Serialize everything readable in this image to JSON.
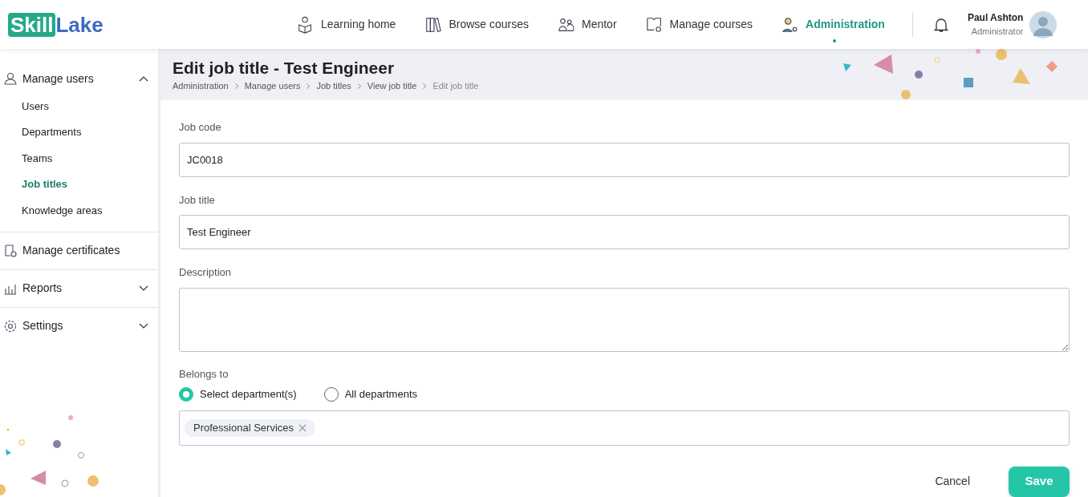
{
  "logo": {
    "part_1": "Skill",
    "part_2": "Lake"
  },
  "nav": [
    {
      "label": "Learning home",
      "selected": false
    },
    {
      "label": "Browse courses",
      "selected": false
    },
    {
      "label": "Mentor",
      "selected": false
    },
    {
      "label": "Manage courses",
      "selected": false
    },
    {
      "label": "Administration",
      "selected": true
    }
  ],
  "user": {
    "name": "Paul Ashton",
    "role": "Administrator"
  },
  "sidebar": {
    "items": [
      {
        "label": "Manage users",
        "expanded": true,
        "children": [
          {
            "label": "Users",
            "selected": false
          },
          {
            "label": "Departments",
            "selected": false
          },
          {
            "label": "Teams",
            "selected": false
          },
          {
            "label": "Job titles",
            "selected": true
          },
          {
            "label": "Knowledge areas",
            "selected": false
          }
        ]
      },
      {
        "label": "Manage certificates"
      },
      {
        "label": "Reports",
        "expanded": false
      },
      {
        "label": "Settings",
        "expanded": false
      }
    ]
  },
  "page": {
    "title": "Edit job title - Test Engineer",
    "breadcrumb": [
      "Administration",
      "Manage users",
      "Job titles",
      "View job title",
      "Edit job title"
    ]
  },
  "form": {
    "job_code": {
      "label": "Job code",
      "value": "JC0018"
    },
    "job_title": {
      "label": "Job title",
      "value": "Test Engineer"
    },
    "description": {
      "label": "Description"
    },
    "belongs_to": {
      "label": "Belongs to",
      "options": [
        {
          "label": "Select department(s)",
          "selected": true
        },
        {
          "label": "All departments",
          "selected": false
        }
      ],
      "tags": [
        "Professional Services"
      ]
    }
  },
  "buttons": {
    "cancel": "Cancel",
    "save": "Save"
  }
}
